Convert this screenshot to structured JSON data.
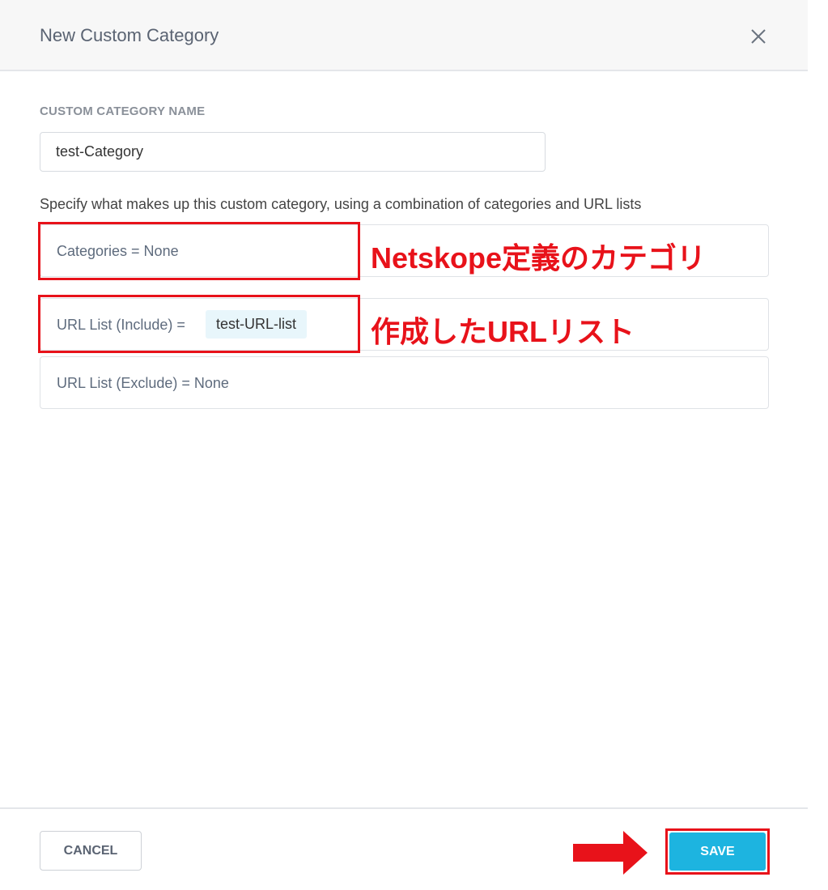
{
  "modal": {
    "title": "New Custom Category",
    "close_icon": "close-icon"
  },
  "form": {
    "name_label": "CUSTOM CATEGORY NAME",
    "name_value": "test-Category",
    "description": "Specify what makes up this custom category, using a combination of categories and URL lists"
  },
  "rules": {
    "categories": "Categories = None",
    "url_include_label": "URL List (Include) =",
    "url_include_chip": "test-URL-list",
    "url_exclude": "URL List (Exclude) = None"
  },
  "annotations": {
    "categories_note": "Netskope定義のカテゴリ",
    "url_list_note": "作成したURLリスト",
    "highlight_color": "#e8121a",
    "arrow_icon": "right-arrow-icon"
  },
  "footer": {
    "cancel_label": "CANCEL",
    "save_label": "SAVE"
  },
  "colors": {
    "accent": "#1db4e0",
    "chip_bg": "#e8f6fb"
  }
}
